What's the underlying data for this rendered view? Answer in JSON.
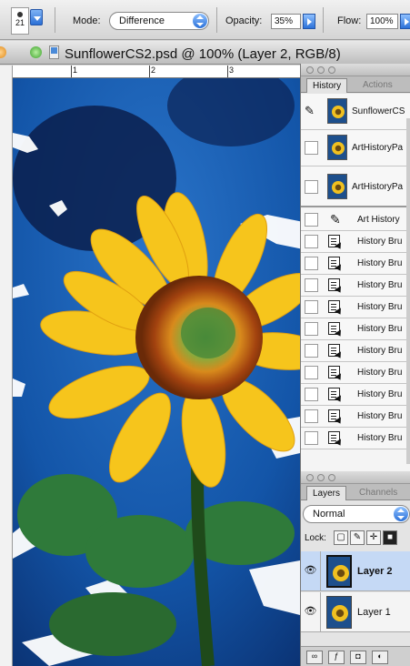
{
  "options_bar": {
    "brush_size": "21",
    "mode_label": "Mode:",
    "mode_value": "Difference",
    "opacity_label": "Opacity:",
    "opacity_value": "35%",
    "flow_label": "Flow:",
    "flow_value": "100%"
  },
  "document": {
    "title": "SunflowerCS2.psd @ 100% (Layer 2, RGB/8)",
    "ruler_marks": [
      "1",
      "2",
      "3"
    ]
  },
  "history_panel": {
    "tabs": [
      "History",
      "Actions"
    ],
    "items": [
      {
        "label": "SunflowerCS",
        "icon": "snapshot-thumbnail",
        "kind": "snapshot"
      },
      {
        "label": "ArtHistoryPa",
        "icon": "snapshot-thumbnail",
        "kind": "snapshot"
      },
      {
        "label": "ArtHistoryPa",
        "icon": "snapshot-thumbnail",
        "kind": "snapshot"
      },
      {
        "label": "Art History",
        "icon": "art-history-brush-icon",
        "kind": "step"
      },
      {
        "label": "History Bru",
        "icon": "history-brush-step-icon",
        "kind": "step"
      },
      {
        "label": "History Bru",
        "icon": "history-brush-step-icon",
        "kind": "step"
      },
      {
        "label": "History Bru",
        "icon": "history-brush-step-icon",
        "kind": "step"
      },
      {
        "label": "History Bru",
        "icon": "history-brush-step-icon",
        "kind": "step"
      },
      {
        "label": "History Bru",
        "icon": "history-brush-step-icon",
        "kind": "step"
      },
      {
        "label": "History Bru",
        "icon": "history-brush-step-icon",
        "kind": "step"
      },
      {
        "label": "History Bru",
        "icon": "history-brush-step-icon",
        "kind": "step"
      },
      {
        "label": "History Bru",
        "icon": "history-brush-step-icon",
        "kind": "step"
      },
      {
        "label": "History Bru",
        "icon": "history-brush-step-icon",
        "kind": "step"
      },
      {
        "label": "History Bru",
        "icon": "history-brush-step-icon",
        "kind": "step"
      }
    ]
  },
  "layers_panel": {
    "tabs": [
      "Layers",
      "Channels"
    ],
    "blend_mode": "Normal",
    "lock_label": "Lock:",
    "layers": [
      {
        "name": "Layer 2",
        "selected": true,
        "visible": true
      },
      {
        "name": "Layer 1",
        "selected": false,
        "visible": true
      }
    ]
  },
  "colors": {
    "selection_blue": "#c5d9f5",
    "accent_blue": "#2b71d8"
  }
}
